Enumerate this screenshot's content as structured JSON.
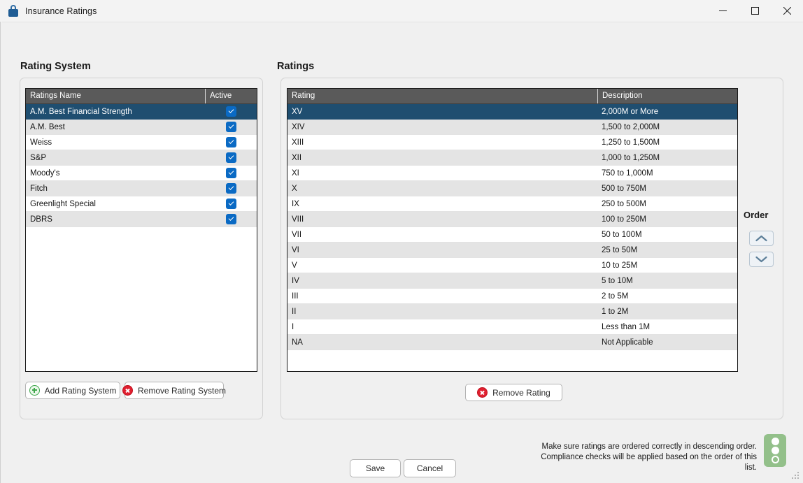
{
  "window": {
    "title": "Insurance Ratings",
    "lock_icon": "lock-icon",
    "minimize_label": "Minimize",
    "maximize_label": "Maximize",
    "close_label": "Close"
  },
  "left_panel": {
    "title": "Rating System",
    "grid": {
      "columns": [
        "Ratings Name",
        "Active"
      ],
      "rows": [
        {
          "name": "A.M. Best Financial Strength",
          "active": true,
          "selected": true
        },
        {
          "name": "A.M. Best",
          "active": true,
          "selected": false
        },
        {
          "name": "Weiss",
          "active": true,
          "selected": false
        },
        {
          "name": "S&P",
          "active": true,
          "selected": false
        },
        {
          "name": "Moody's",
          "active": true,
          "selected": false
        },
        {
          "name": "Fitch",
          "active": true,
          "selected": false
        },
        {
          "name": "Greenlight Special",
          "active": true,
          "selected": false
        },
        {
          "name": "DBRS",
          "active": true,
          "selected": false
        }
      ]
    },
    "add_button": {
      "label": "Add Rating System",
      "icon": "circle-plus-icon"
    },
    "remove_button": {
      "label": "Remove Rating System",
      "icon": "circle-x-icon"
    }
  },
  "right_panel": {
    "title": "Ratings",
    "grid": {
      "columns": [
        "Rating",
        "Description"
      ],
      "rows": [
        {
          "rating": "XV",
          "description": "2,000M or More",
          "selected": true
        },
        {
          "rating": "XIV",
          "description": "1,500 to 2,000M",
          "selected": false
        },
        {
          "rating": "XIII",
          "description": "1,250 to 1,500M",
          "selected": false
        },
        {
          "rating": "XII",
          "description": "1,000 to 1,250M",
          "selected": false
        },
        {
          "rating": "XI",
          "description": "750 to 1,000M",
          "selected": false
        },
        {
          "rating": "X",
          "description": "500 to 750M",
          "selected": false
        },
        {
          "rating": "IX",
          "description": "250 to 500M",
          "selected": false
        },
        {
          "rating": "VIII",
          "description": "100 to 250M",
          "selected": false
        },
        {
          "rating": "VII",
          "description": "50 to 100M",
          "selected": false
        },
        {
          "rating": "VI",
          "description": "25 to 50M",
          "selected": false
        },
        {
          "rating": "V",
          "description": "10 to 25M",
          "selected": false
        },
        {
          "rating": "IV",
          "description": "5 to 10M",
          "selected": false
        },
        {
          "rating": "III",
          "description": "2 to 5M",
          "selected": false
        },
        {
          "rating": "II",
          "description": "1 to 2M",
          "selected": false
        },
        {
          "rating": "I",
          "description": "Less than 1M",
          "selected": false
        },
        {
          "rating": "NA",
          "description": "Not Applicable",
          "selected": false
        }
      ]
    },
    "remove_button": {
      "label": "Remove Rating",
      "icon": "circle-x-icon"
    }
  },
  "order": {
    "label": "Order",
    "up_icon": "chevron-up-icon",
    "down_icon": "chevron-down-icon"
  },
  "footer": {
    "note_line1": "Make sure ratings are ordered correctly in descending order.",
    "note_line2": "Compliance checks will be applied based on the order of this list.",
    "note_icon": "traffic-light-icon",
    "save_label": "Save",
    "cancel_label": "Cancel"
  },
  "colors": {
    "selection": "#1f4e70",
    "header": "#5a5a5a",
    "checkbox": "#0a6ac4",
    "add_icon": "#3da64a",
    "remove_icon": "#e02030",
    "note_icon": "#93c08a"
  }
}
